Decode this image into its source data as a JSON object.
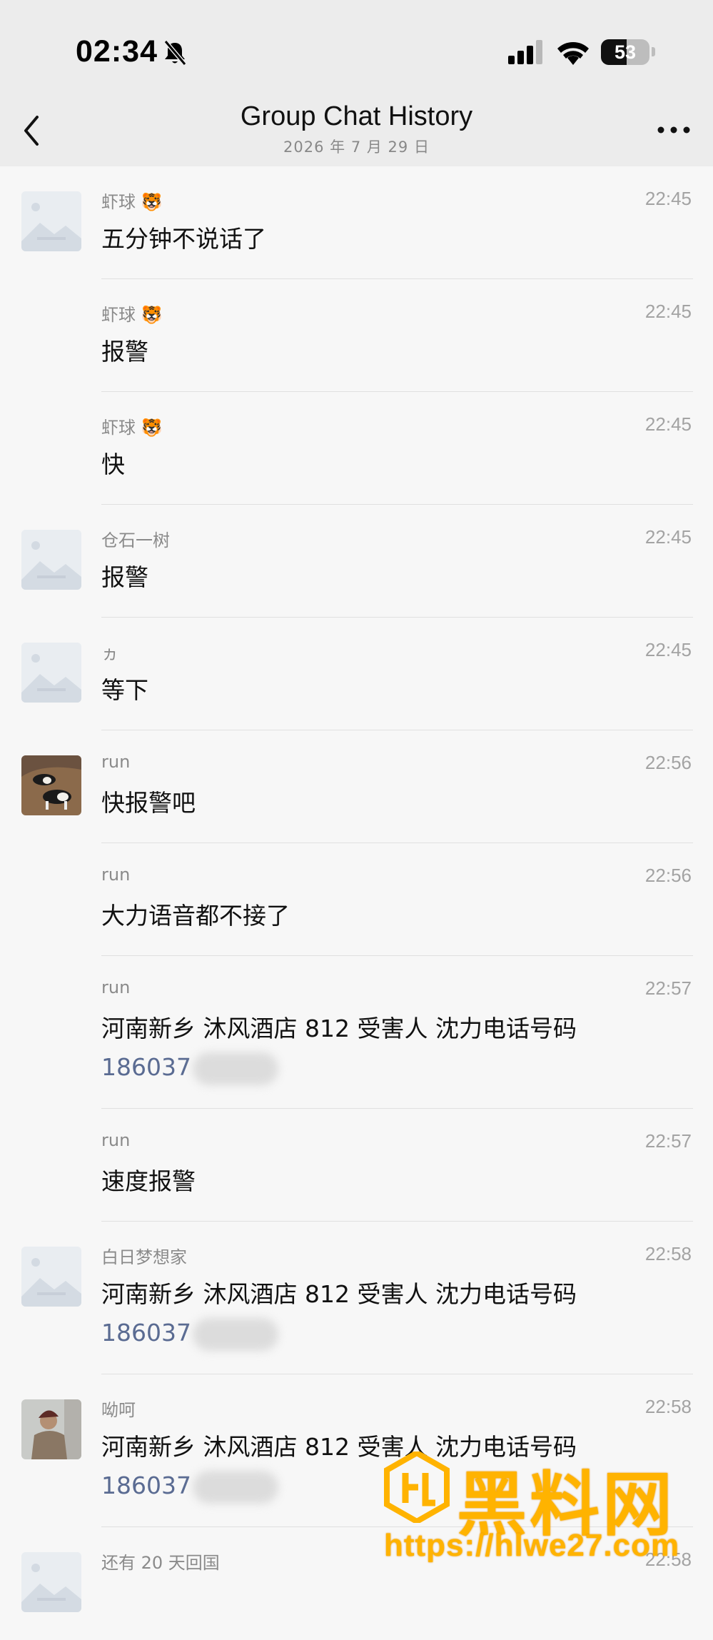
{
  "status_bar": {
    "time": "02:34",
    "battery": "53",
    "battery_level": 0.53
  },
  "nav": {
    "title": "Group Chat History",
    "subtitle": "2026 年 7 月 29 日"
  },
  "messages": [
    {
      "sender": "虾球",
      "sender_badge": "🐯",
      "time": "22:45",
      "text": "五分钟不说话了",
      "avatar": "placeholder"
    },
    {
      "sender": "虾球",
      "sender_badge": "🐯",
      "time": "22:45",
      "text": "报警",
      "avatar": "none"
    },
    {
      "sender": "虾球",
      "sender_badge": "🐯",
      "time": "22:45",
      "text": "快",
      "avatar": "none"
    },
    {
      "sender": "仓石一树",
      "sender_badge": "",
      "time": "22:45",
      "text": "报警",
      "avatar": "placeholder"
    },
    {
      "sender": "ヵ",
      "sender_badge": "",
      "time": "22:45",
      "text": "等下",
      "avatar": "placeholder"
    },
    {
      "sender": "run",
      "sender_badge": "",
      "time": "22:56",
      "text": "快报警吧",
      "avatar": "dogs-photo"
    },
    {
      "sender": "run",
      "sender_badge": "",
      "time": "22:56",
      "text": "大力语音都不接了",
      "avatar": "none"
    },
    {
      "sender": "run",
      "sender_badge": "",
      "time": "22:57",
      "text": "河南新乡 沐风酒店 812 受害人 沈力电话号码",
      "phone": "186037",
      "avatar": "none"
    },
    {
      "sender": "run",
      "sender_badge": "",
      "time": "22:57",
      "text": "速度报警",
      "avatar": "none"
    },
    {
      "sender": "白日梦想家",
      "sender_badge": "",
      "time": "22:58",
      "text": "河南新乡 沐风酒店 812 受害人 沈力电话号码",
      "phone": "186037",
      "avatar": "placeholder"
    },
    {
      "sender": "呦呵",
      "sender_badge": "",
      "time": "22:58",
      "text": "河南新乡 沐风酒店 812 受害人 沈力电话号码",
      "phone": "186037",
      "avatar": "person-photo"
    },
    {
      "sender": "还有 20 天回国",
      "sender_badge": "",
      "time": "22:58",
      "text": "",
      "avatar": "placeholder"
    }
  ],
  "watermark": {
    "name": "黑料网",
    "url": "https://hlwe27.com",
    "color": "#ffb300"
  }
}
